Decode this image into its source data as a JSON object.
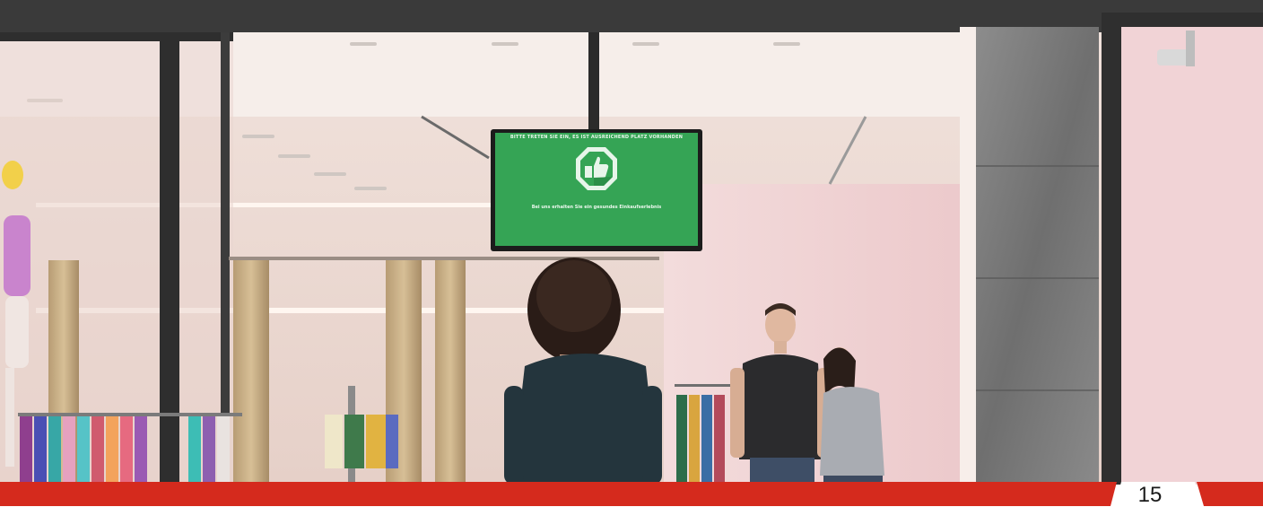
{
  "store_display": {
    "title": "BITTE TRETEN SIE EIN, ES IST AUSREICHEND PLATZ VORHANDEN",
    "message": "Bei uns erhalten Sie ein gesundes Einkaufserlebnis",
    "icon": "thumbs-up-icon",
    "background_color": "#35a455"
  },
  "footer": {
    "page_number": "15",
    "accent_color": "#d52a1d"
  }
}
